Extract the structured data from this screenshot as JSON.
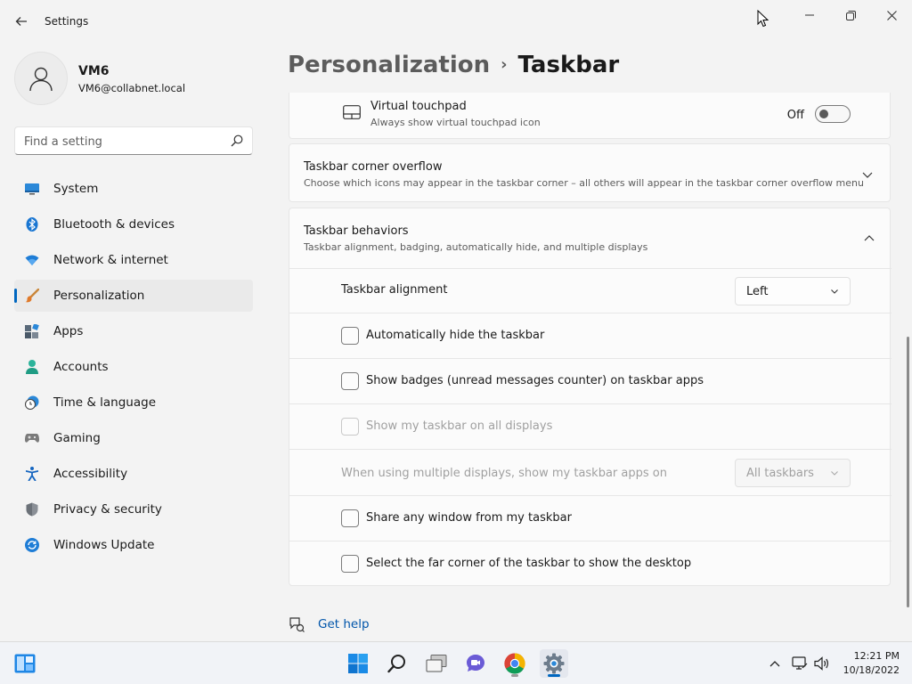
{
  "window": {
    "title": "Settings"
  },
  "user": {
    "name": "VM6",
    "email": "VM6@collabnet.local"
  },
  "search": {
    "placeholder": "Find a setting"
  },
  "sidebar": {
    "items": [
      {
        "label": "System",
        "icon": "monitor-icon"
      },
      {
        "label": "Bluetooth & devices",
        "icon": "bluetooth-icon"
      },
      {
        "label": "Network & internet",
        "icon": "wifi-icon"
      },
      {
        "label": "Personalization",
        "icon": "paintbrush-icon",
        "selected": true
      },
      {
        "label": "Apps",
        "icon": "apps-icon"
      },
      {
        "label": "Accounts",
        "icon": "person-icon"
      },
      {
        "label": "Time & language",
        "icon": "clock-globe-icon"
      },
      {
        "label": "Gaming",
        "icon": "gamepad-icon"
      },
      {
        "label": "Accessibility",
        "icon": "accessibility-icon"
      },
      {
        "label": "Privacy & security",
        "icon": "shield-icon"
      },
      {
        "label": "Windows Update",
        "icon": "update-icon"
      }
    ]
  },
  "breadcrumb": {
    "parent": "Personalization",
    "separator": "›",
    "current": "Taskbar"
  },
  "virtual_touchpad": {
    "title": "Virtual touchpad",
    "subtitle": "Always show virtual touchpad icon",
    "state": "Off"
  },
  "corner_overflow": {
    "title": "Taskbar corner overflow",
    "subtitle": "Choose which icons may appear in the taskbar corner – all others will appear in the taskbar corner overflow menu"
  },
  "behaviors": {
    "title": "Taskbar behaviors",
    "subtitle": "Taskbar alignment, badging, automatically hide, and multiple displays",
    "alignment_label": "Taskbar alignment",
    "alignment_value": "Left",
    "auto_hide": "Automatically hide the taskbar",
    "badges": "Show badges (unread messages counter) on taskbar apps",
    "all_displays": "Show my taskbar on all displays",
    "multi_display_label": "When using multiple displays, show my taskbar apps on",
    "multi_display_value": "All taskbars",
    "share_window": "Share any window from my taskbar",
    "far_corner": "Select the far corner of the taskbar to show the desktop"
  },
  "help": {
    "label": "Get help"
  },
  "taskbar": {
    "clock_time": "12:21 PM",
    "clock_date": "10/18/2022"
  },
  "colors": {
    "accent": "#0067c0",
    "link": "#0055aa",
    "background": "#f3f3f3"
  }
}
